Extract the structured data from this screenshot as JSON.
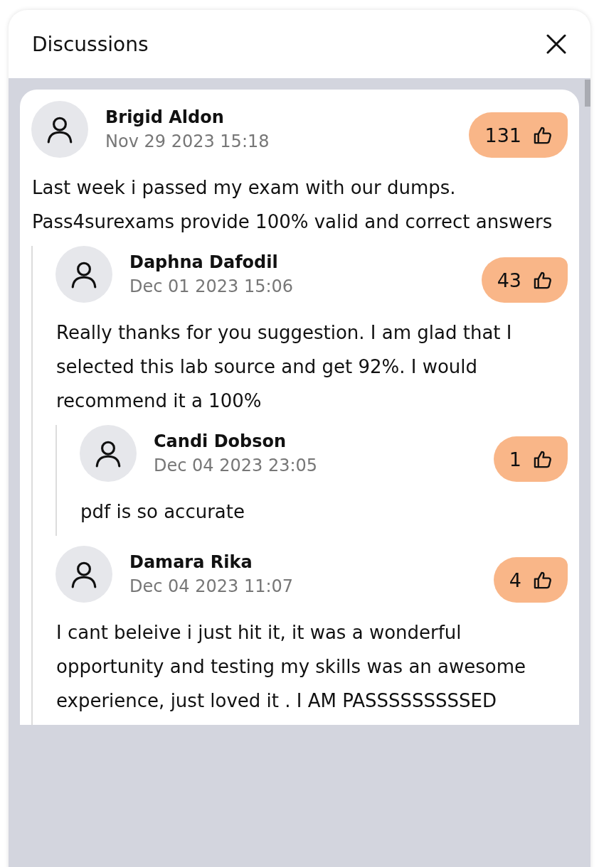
{
  "window": {
    "title": "Discussions"
  },
  "comments": [
    {
      "author": "Brigid Aldon",
      "date": "Nov 29 2023 15:18",
      "likes": "131",
      "text": "Last week i passed my exam with our dumps. Pass4surexams provide 100% valid and correct answers",
      "children": [
        {
          "author": "Daphna Dafodil",
          "date": "Dec 01 2023 15:06",
          "likes": "43",
          "text": "Really thanks for you suggestion. I am glad that I selected this lab source and get 92%. I would recommend it a 100%",
          "children": [
            {
              "author": "Candi Dobson",
              "date": "Dec 04 2023 23:05",
              "likes": "1",
              "text": "pdf is so accurate"
            }
          ]
        },
        {
          "author": "Damara Rika",
          "date": "Dec 04 2023 11:07",
          "likes": "4",
          "text": "I cant beleive i just hit it, it was a wonderful opportunity and testing my skills was an awesome experience, just loved it . I AM PASSSSSSSSSED"
        }
      ]
    }
  ]
}
